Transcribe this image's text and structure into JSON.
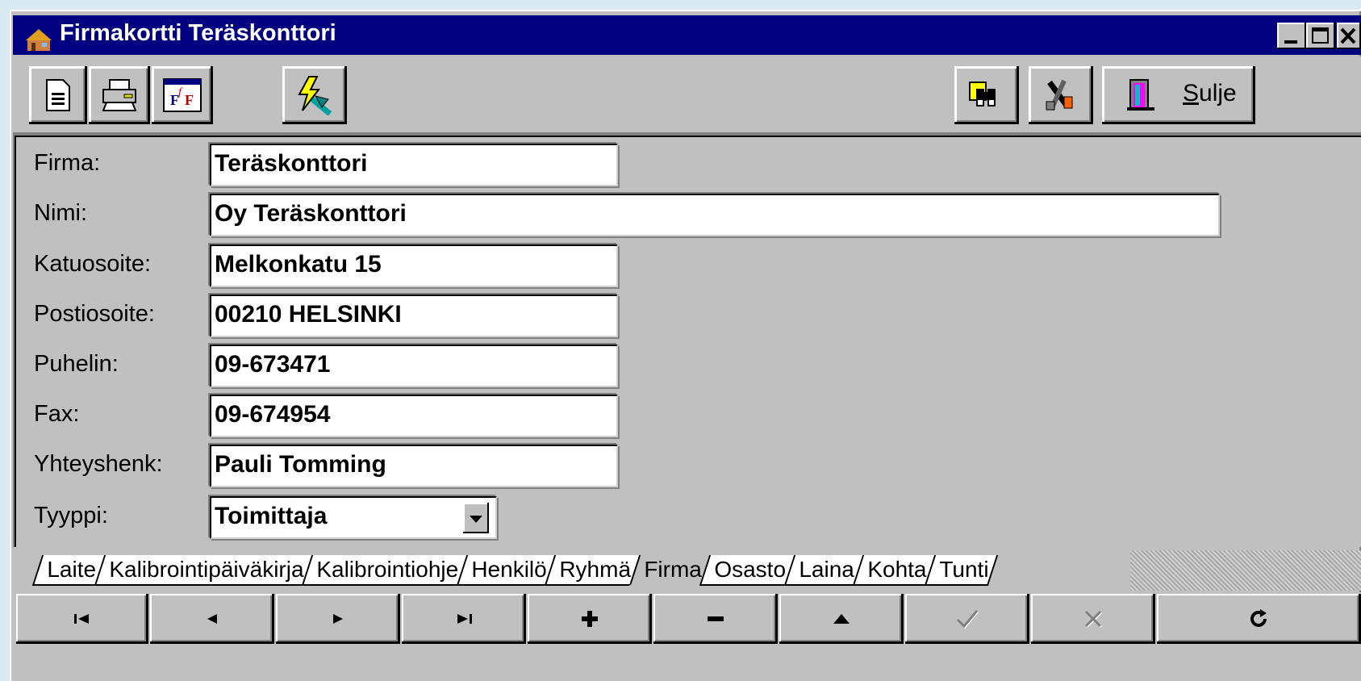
{
  "window": {
    "title": "Firmakortti Teräskonttori",
    "controls": [
      "minimize-icon",
      "maximize-icon",
      "close-icon"
    ]
  },
  "toolbar": {
    "left_icons": [
      "new-record-icon",
      "print-icon",
      "font-icon"
    ],
    "lightning_icon": "lightning-tool-icon",
    "right_icons": [
      "binoculars-icon",
      "tools-icon"
    ],
    "close_label": "Sulje",
    "close_accelerator": "S"
  },
  "form": {
    "fields": [
      {
        "label": "Firma:",
        "value": "Teräskonttori"
      },
      {
        "label": "Nimi:",
        "value": "Oy Teräskonttori"
      },
      {
        "label": "Katuosoite:",
        "value": "Melkonkatu 15"
      },
      {
        "label": "Postiosoite:",
        "value": "00210 HELSINKI"
      },
      {
        "label": "Puhelin:",
        "value": "09-673471"
      },
      {
        "label": "Fax:",
        "value": "09-674954"
      },
      {
        "label": "Yhteyshenk:",
        "value": "Pauli Tomming"
      }
    ],
    "type_field": {
      "label": "Tyyppi:",
      "value": "Toimittaja"
    }
  },
  "tabs": [
    "Laite",
    "Kalibrointipäiväkirja",
    "Kalibrointiohje",
    "Henkilö",
    "Ryhmä",
    "Firma",
    "Osasto",
    "Laina",
    "Kohta",
    "Tunti"
  ],
  "active_tab": "Firma",
  "navigation": [
    "first-record-icon",
    "previous-record-icon",
    "next-record-icon",
    "last-record-icon",
    "add-record-icon",
    "delete-record-icon",
    "edit-record-icon",
    "save-record-icon",
    "cancel-record-icon",
    "refresh-icon"
  ],
  "colors": {
    "titlebar": "#000080",
    "face": "#c0c0c0",
    "field": "#ffffff"
  }
}
